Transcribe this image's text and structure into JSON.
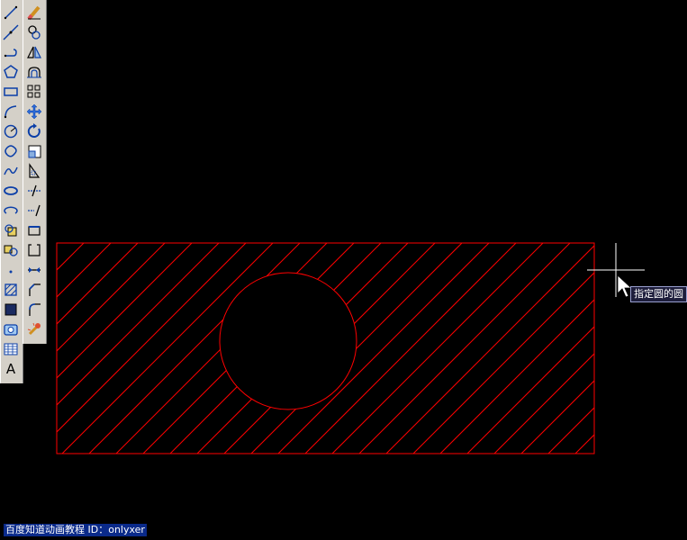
{
  "draw_toolbar": {
    "tools": [
      "line-icon",
      "construction-line-icon",
      "polyline-icon",
      "polygon-icon",
      "rectangle-icon",
      "arc-icon",
      "circle-icon",
      "revision-cloud-icon",
      "spline-icon",
      "ellipse-icon",
      "ellipse-arc-icon",
      "insert-block-icon",
      "make-block-icon",
      "point-icon",
      "hatch-icon",
      "gradient-icon",
      "region-icon",
      "table-icon",
      "multiline-text-icon"
    ],
    "text_tool_label": "A"
  },
  "modify_toolbar": {
    "tools": [
      "erase-icon",
      "copy-icon",
      "mirror-icon",
      "offset-icon",
      "array-icon",
      "move-icon",
      "rotate-icon",
      "scale-icon",
      "stretch-icon",
      "trim-icon",
      "extend-icon",
      "break-at-point-icon",
      "break-icon",
      "join-icon",
      "chamfer-icon",
      "fillet-icon",
      "explode-icon"
    ]
  },
  "drawing": {
    "line_color": "#ff0000",
    "background": "#000000",
    "cursor_color": "#ffffff"
  },
  "tooltip": {
    "text": "指定圆的圆"
  },
  "watermark": {
    "text": "百度知道动画教程 ID：onlyxer"
  }
}
